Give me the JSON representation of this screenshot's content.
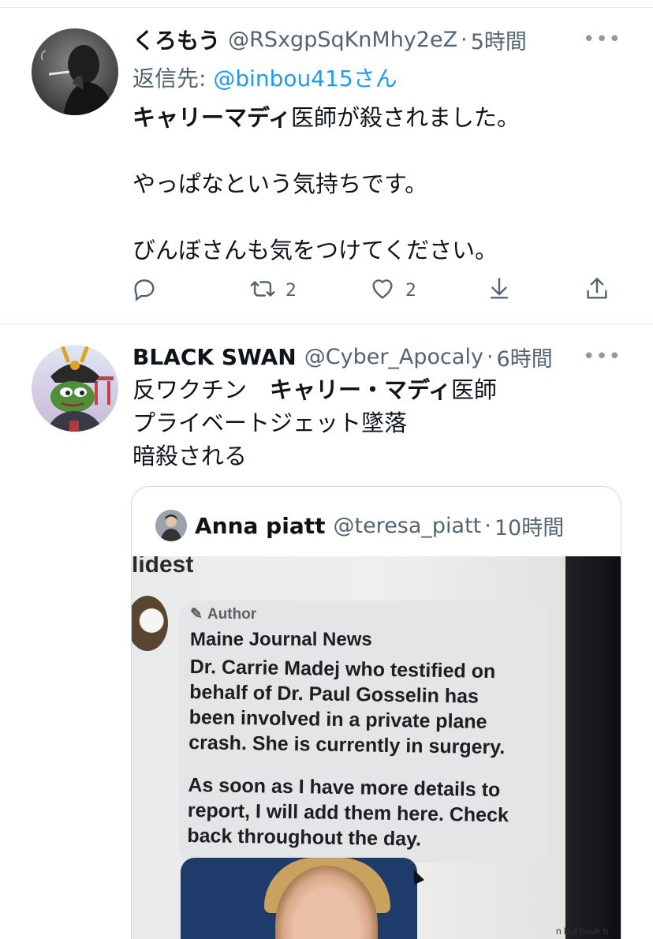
{
  "tweets": [
    {
      "name": "くろもう",
      "handle": "@RSxgpSqKnMhy2eZ",
      "separator": "·",
      "time": "5時間",
      "more": "•••",
      "reply_prefix": "返信先: ",
      "reply_mention": "@binbou415",
      "reply_suffix": "さん",
      "body": {
        "line1_bold": "キャリーマディ",
        "line1_rest": "医師が殺されました。",
        "line2": "やっぱなという気持ちです。",
        "line3": "びんぼさんも気をつけてください。"
      },
      "actions": {
        "reply_icon": "reply-icon",
        "retweet_icon": "retweet-icon",
        "retweet_count": "2",
        "like_icon": "heart-icon",
        "like_count": "2",
        "download_icon": "download-icon",
        "share_icon": "share-icon"
      }
    },
    {
      "name": "BLACK SWAN",
      "handle": "@Cyber_Apocaly",
      "separator": "·",
      "time": "6時間",
      "more": "•••",
      "body": {
        "line1_pre": "反ワクチン　",
        "line1_bold": "キャリー・マディ",
        "line1_rest": "医師",
        "line2": "プライベートジェット墜落",
        "line3": "暗殺される"
      },
      "quote": {
        "name": "Anna piatt",
        "handle": "@teresa_piatt",
        "separator": "·",
        "time": "10時間",
        "photo": {
          "cut_text": "lidest",
          "author_label": "Author",
          "source": "Maine Journal News",
          "body_lines": [
            "Dr. Carrie Madej who testified on",
            "behalf of Dr. Paul Gosselin has",
            "been involved in a private plane",
            "crash. She is currently in surgery."
          ],
          "body_lines_2": [
            "As soon as I have more details to",
            "report, I will add them here. Check",
            "back throughout the day."
          ],
          "corner_text": "n but have b"
        }
      }
    }
  ],
  "colors": {
    "link": "#1d9bf0",
    "secondary": "#536471",
    "border": "#cfd9de"
  }
}
